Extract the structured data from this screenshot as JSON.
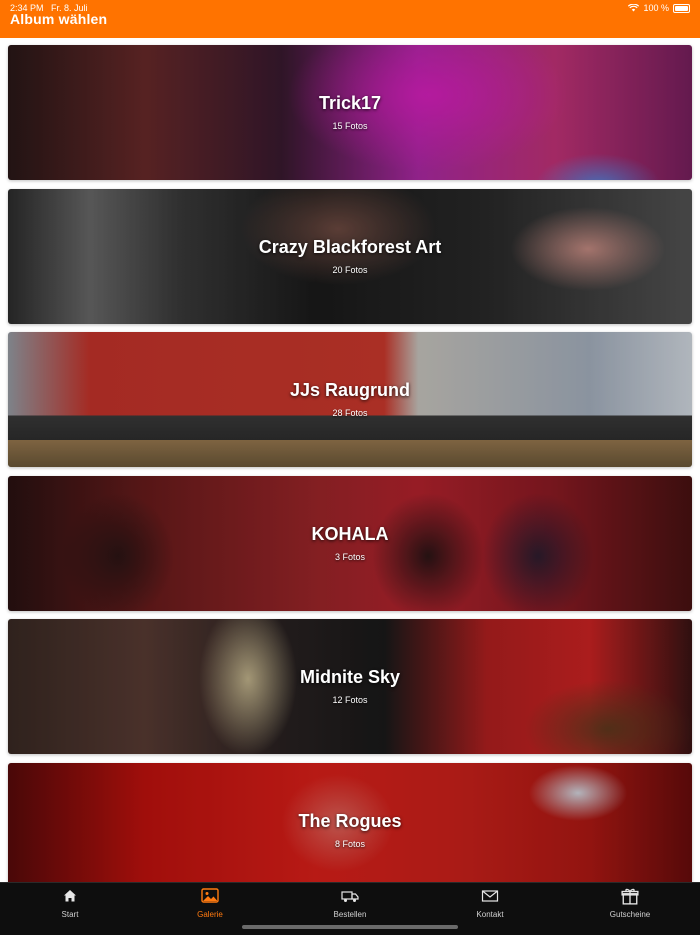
{
  "status_bar": {
    "time": "2:34 PM",
    "date": "Fr. 8. Juli",
    "battery": "100 %",
    "wifi_icon": "wifi-icon",
    "battery_icon": "battery-icon"
  },
  "header": {
    "title": "Album wählen",
    "background_color": "#ff7300"
  },
  "albums": [
    {
      "name": "Trick17",
      "count": "15 Fotos"
    },
    {
      "name": "Crazy Blackforest Art",
      "count": "20 Fotos"
    },
    {
      "name": "JJs Raugrund",
      "count": "28 Fotos"
    },
    {
      "name": "KOHALA",
      "count": "3 Fotos"
    },
    {
      "name": "Midnite Sky",
      "count": "12 Fotos"
    },
    {
      "name": "The Rogues",
      "count": "8 Fotos"
    }
  ],
  "tabbar": {
    "active_color": "#ff7a10",
    "items": [
      {
        "label": "Start",
        "icon": "home-icon"
      },
      {
        "label": "Galerie",
        "icon": "gallery-icon",
        "active": true
      },
      {
        "label": "Bestellen",
        "icon": "truck-icon"
      },
      {
        "label": "Kontakt",
        "icon": "envelope-icon"
      },
      {
        "label": "Gutscheine",
        "icon": "gift-icon"
      }
    ]
  }
}
